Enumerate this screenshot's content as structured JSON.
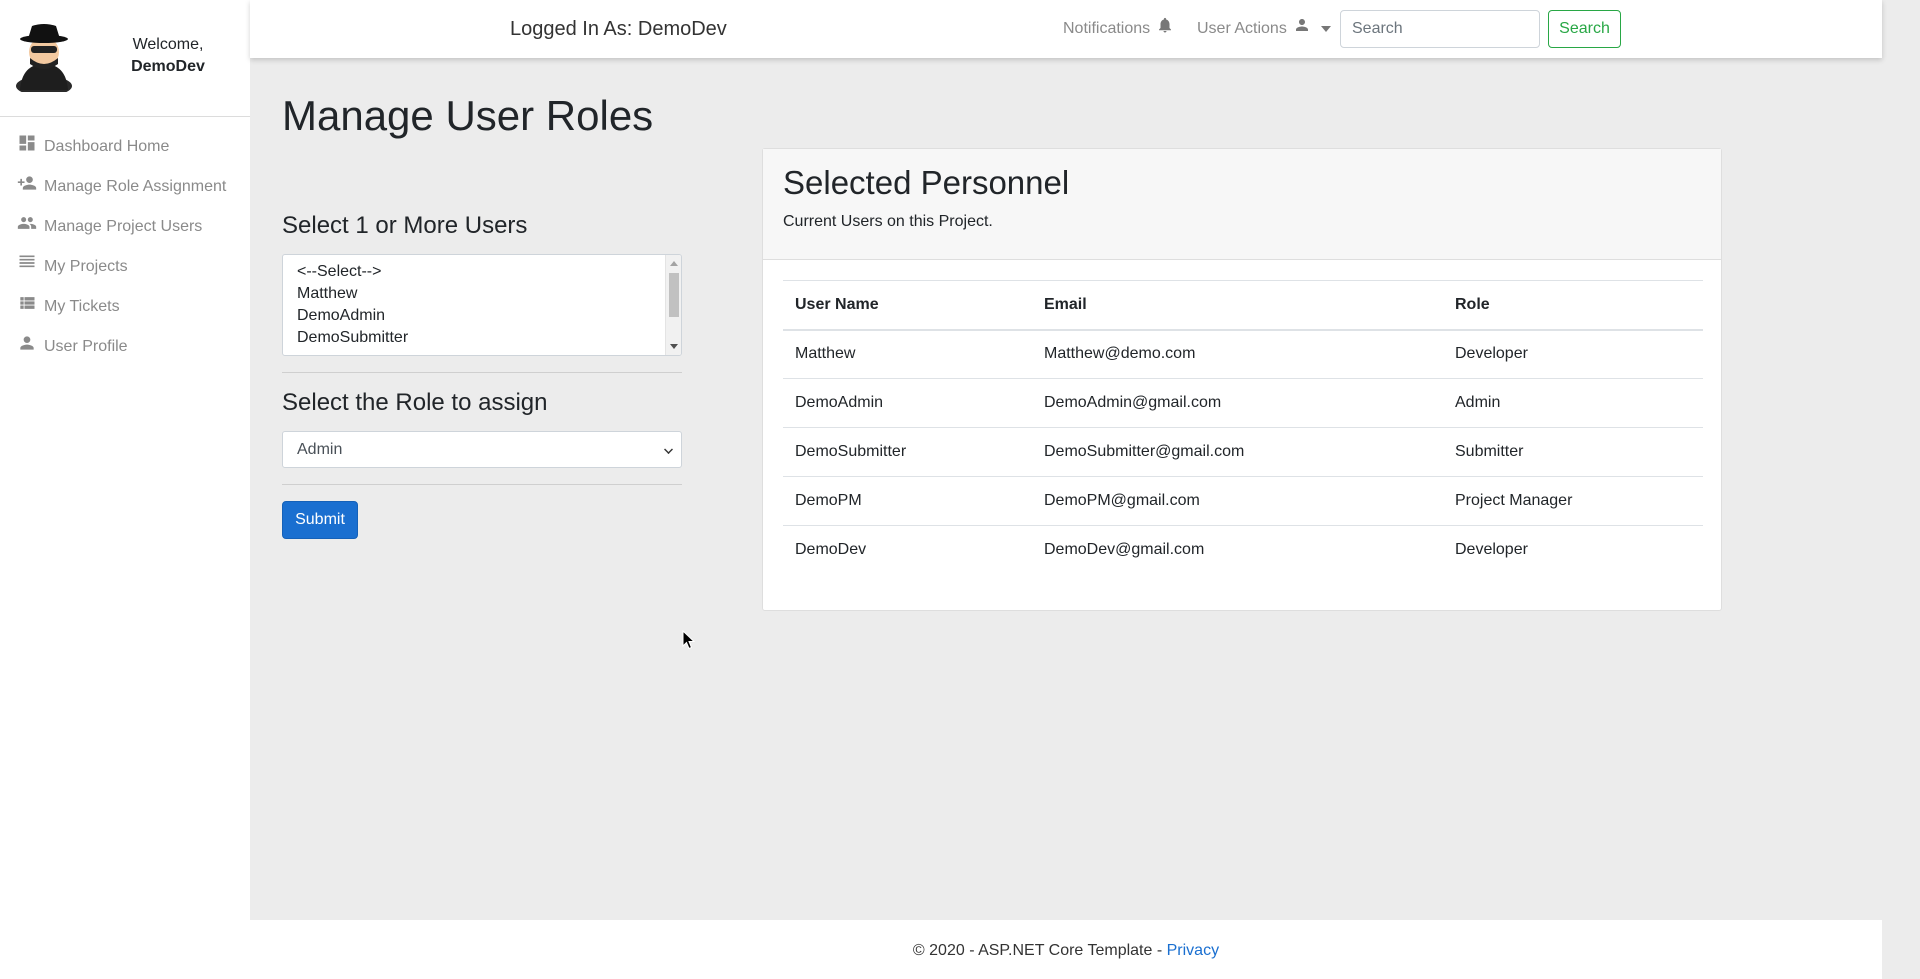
{
  "sidebar": {
    "welcome": "Welcome,",
    "username": "DemoDev",
    "items": [
      {
        "label": "Dashboard Home",
        "icon": "dashboard-icon"
      },
      {
        "label": "Manage Role Assignment",
        "icon": "person-add-icon"
      },
      {
        "label": "Manage Project Users",
        "icon": "people-icon"
      },
      {
        "label": "My Projects",
        "icon": "list-icon"
      },
      {
        "label": "My Tickets",
        "icon": "list-view-icon"
      },
      {
        "label": "User Profile",
        "icon": "person-icon"
      }
    ]
  },
  "topbar": {
    "logged_in": "Logged In As: DemoDev",
    "notifications": "Notifications",
    "user_actions": "User Actions",
    "search_placeholder": "Search",
    "search_button": "Search"
  },
  "main": {
    "title": "Manage User Roles",
    "select_users_label": "Select 1 or More Users",
    "user_options": [
      "<--Select-->",
      "Matthew",
      "DemoAdmin",
      "DemoSubmitter"
    ],
    "role_label": "Select the Role to assign",
    "role_selected": "Admin",
    "submit": "Submit"
  },
  "card": {
    "title": "Selected Personnel",
    "subtitle": "Current Users on this Project.",
    "headers": [
      "User Name",
      "Email",
      "Role"
    ],
    "rows": [
      [
        "Matthew",
        "Matthew@demo.com",
        "Developer"
      ],
      [
        "DemoAdmin",
        "DemoAdmin@gmail.com",
        "Admin"
      ],
      [
        "DemoSubmitter",
        "DemoSubmitter@gmail.com",
        "Submitter"
      ],
      [
        "DemoPM",
        "DemoPM@gmail.com",
        "Project Manager"
      ],
      [
        "DemoDev",
        "DemoDev@gmail.com",
        "Developer"
      ]
    ]
  },
  "footer": {
    "text": "© 2020 - ASP.NET Core Template - ",
    "link": "Privacy"
  },
  "colors": {
    "primary": "#1a6fd0",
    "success": "#28a745",
    "muted": "#8a8a8a",
    "background": "#ececec"
  }
}
